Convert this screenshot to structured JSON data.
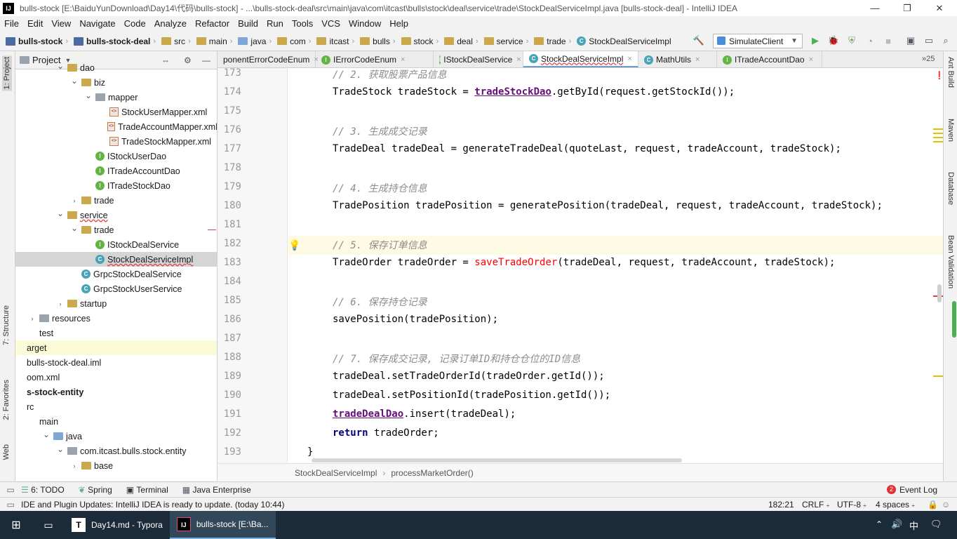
{
  "window": {
    "title": "bulls-stock [E:\\BaiduYunDownload\\Day14\\代码\\bulls-stock] - ...\\bulls-stock-deal\\src\\main\\java\\com\\itcast\\bulls\\stock\\deal\\service\\trade\\StockDealServiceImpl.java [bulls-stock-deal] - IntelliJ IDEA",
    "app_icon_text": "IJ"
  },
  "menu": [
    "File",
    "Edit",
    "View",
    "Navigate",
    "Code",
    "Analyze",
    "Refactor",
    "Build",
    "Run",
    "Tools",
    "VCS",
    "Window",
    "Help"
  ],
  "breadcrumb": [
    "bulls-stock",
    "bulls-stock-deal",
    "src",
    "main",
    "java",
    "com",
    "itcast",
    "bulls",
    "stock",
    "deal",
    "service",
    "trade",
    "StockDealServiceImpl"
  ],
  "run_config": "SimulateClient",
  "project_panel": {
    "title": "Project",
    "tree": [
      {
        "label": "dao",
        "type": "folder",
        "arrow": "v"
      },
      {
        "label": "biz",
        "type": "folder",
        "arrow": "v"
      },
      {
        "label": "mapper",
        "type": "folder-gray",
        "arrow": "v"
      },
      {
        "label": "StockUserMapper.xml",
        "type": "xml"
      },
      {
        "label": "TradeAccountMapper.xml",
        "type": "xml"
      },
      {
        "label": "TradeStockMapper.xml",
        "type": "xml"
      },
      {
        "label": "IStockUserDao",
        "type": "iface"
      },
      {
        "label": "ITradeAccountDao",
        "type": "iface"
      },
      {
        "label": "ITradeStockDao",
        "type": "iface"
      },
      {
        "label": "trade",
        "type": "folder",
        "arrow": ">"
      },
      {
        "label": "service",
        "type": "folder",
        "arrow": "v"
      },
      {
        "label": "trade",
        "type": "folder",
        "arrow": "v"
      },
      {
        "label": "IStockDealService",
        "type": "iface"
      },
      {
        "label": "StockDealServiceImpl",
        "type": "class"
      },
      {
        "label": "GrpcStockDealService",
        "type": "class"
      },
      {
        "label": "GrpcStockUserService",
        "type": "class"
      },
      {
        "label": "startup",
        "type": "folder",
        "arrow": ">"
      },
      {
        "label": "resources",
        "type": "folder-gray",
        "arrow": ">"
      },
      {
        "label": "test",
        "type": "folder",
        "arrow": ""
      },
      {
        "label": "arget",
        "type": "folder",
        "arrow": ""
      },
      {
        "label": "bulls-stock-deal.iml",
        "type": "file"
      },
      {
        "label": "oom.xml",
        "type": "file"
      },
      {
        "label": "s-stock-entity",
        "type": "module"
      },
      {
        "label": "rc",
        "type": "folder",
        "arrow": ""
      },
      {
        "label": "main",
        "type": "folder",
        "arrow": ""
      },
      {
        "label": "java",
        "type": "folder-blue",
        "arrow": "v"
      },
      {
        "label": "com.itcast.bulls.stock.entity",
        "type": "folder-gray",
        "arrow": "v"
      },
      {
        "label": "base",
        "type": "folder",
        "arrow": ">"
      }
    ]
  },
  "tabs": [
    {
      "label": "ponentErrorCodeEnum",
      "icon": "enum"
    },
    {
      "label": "IErrorCodeEnum",
      "icon": "iface"
    },
    {
      "label": "IStockDealService",
      "icon": "iface"
    },
    {
      "label": "StockDealServiceImpl",
      "icon": "class"
    },
    {
      "label": "MathUtils",
      "icon": "class"
    },
    {
      "label": "ITradeAccountDao",
      "icon": "iface"
    }
  ],
  "tab_overflow": "25",
  "editor": {
    "lines": [
      {
        "n": "173",
        "html": "<span class='comment'>// 2. 获取股票产品信息</span>"
      },
      {
        "n": "174",
        "html": "TradeStock tradeStock = <span class='field'>tradeStockDao</span>.getById(request.getStockId());"
      },
      {
        "n": "175",
        "html": ""
      },
      {
        "n": "176",
        "html": "<span class='comment'>// 3. 生成成交记录</span>"
      },
      {
        "n": "177",
        "html": "TradeDeal tradeDeal = generateTradeDeal(quoteLast, request, tradeAccount, tradeStock);"
      },
      {
        "n": "178",
        "html": ""
      },
      {
        "n": "179",
        "html": "<span class='comment'>// 4. 生成持仓信息</span>"
      },
      {
        "n": "180",
        "html": "TradePosition tradePosition = generatePosition(tradeDeal, request, tradeAccount, tradeStock);"
      },
      {
        "n": "181",
        "html": ""
      },
      {
        "n": "182",
        "html": "<span class='comment'>// 5. 保存订单信息</span>"
      },
      {
        "n": "183",
        "html": "TradeOrder tradeOrder = <span class='err'>saveTradeOrder</span>(tradeDeal, request, tradeAccount, tradeStock);"
      },
      {
        "n": "184",
        "html": ""
      },
      {
        "n": "185",
        "html": "<span class='comment'>// 6. 保存持仓记录</span>"
      },
      {
        "n": "186",
        "html": "savePosition(tradePosition);"
      },
      {
        "n": "187",
        "html": ""
      },
      {
        "n": "188",
        "html": "<span class='comment'>// 7. 保存成交记录, 记录订单ID和持仓仓位的ID信息</span>"
      },
      {
        "n": "189",
        "html": "tradeDeal.setTradeOrderId(tradeOrder.getId());"
      },
      {
        "n": "190",
        "html": "tradeDeal.setPositionId(tradePosition.getId());"
      },
      {
        "n": "191",
        "html": "<span class='field'>tradeDealDao</span>.insert(tradeDeal);"
      },
      {
        "n": "192",
        "html": "<span class='kw'>return</span> tradeOrder;"
      },
      {
        "n": "193",
        "html": "}"
      }
    ],
    "breadcrumb": [
      "StockDealServiceImpl",
      "processMarketOrder()"
    ]
  },
  "left_tool_tabs": [
    "1: Project",
    "7: Structure",
    "2: Favorites",
    "Web"
  ],
  "right_tool_tabs": [
    "Ant Build",
    "Maven",
    "Database",
    "Bean Validation"
  ],
  "bottom_tools": [
    "6: TODO",
    "Spring",
    "Terminal",
    "Java Enterprise"
  ],
  "event_log": {
    "label": "Event Log",
    "count": "2"
  },
  "status": {
    "message": "IDE and Plugin Updates: IntelliJ IDEA is ready to update. (today 10:44)",
    "position": "182:21",
    "line_sep": "CRLF",
    "encoding": "UTF-8",
    "indent": "4 spaces"
  },
  "taskbar": {
    "items": [
      "Day14.md - Typora",
      "bulls-stock [E:\\Ba..."
    ],
    "ime": "中"
  }
}
